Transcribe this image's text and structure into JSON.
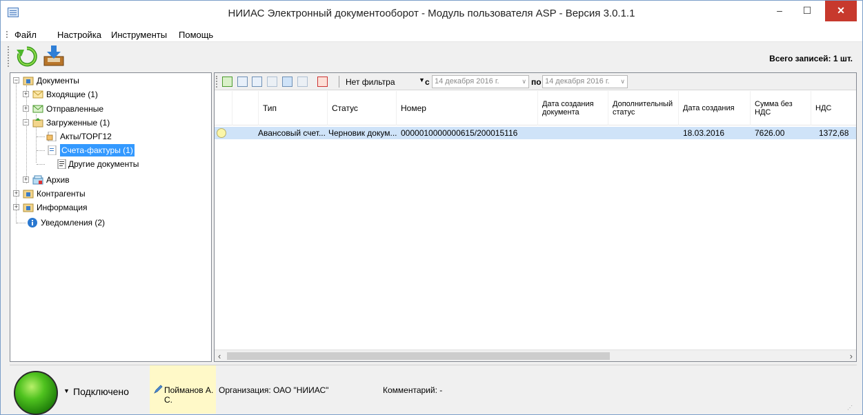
{
  "window": {
    "title": "НИИАС Электронный документооборот - Модуль пользователя ASP - Версия 3.0.1.1",
    "minimize": "–",
    "maximize": "☐",
    "close": "✕"
  },
  "menu": [
    "Файл",
    "Настройка",
    "Инструменты",
    "Помощь"
  ],
  "toolbar": {
    "total_records": "Всего записей: 1 шт.",
    "refresh_icon": "refresh-icon",
    "import_icon": "import-icon"
  },
  "tree": {
    "documents": "Документы",
    "incoming": "Входящие (1)",
    "sent": "Отправленные",
    "loaded": "Загруженные (1)",
    "acts": "Акты/ТОРГ12",
    "invoices": "Счета-фактуры (1)",
    "other_docs": "Другие документы",
    "archive": "Архив",
    "contractors": "Контрагенты",
    "information": "Информация",
    "notifications": "Уведомления (2)"
  },
  "grid_toolbar": {
    "filter": "Нет фильтра",
    "from_label": "с",
    "from_date": "14 декабря  2016 г.",
    "to_label": "по",
    "to_date": "14 декабря  2016 г."
  },
  "grid": {
    "columns": [
      "Тип",
      "Статус",
      "Номер",
      "Дата создания документа",
      "Дополнительный статус",
      "Дата создания",
      "Сумма без НДС",
      "НДС"
    ],
    "rows": [
      {
        "type": "Авансовый счет...",
        "status": "Черновик докум...",
        "number": "0000010000000615/200015116",
        "doc_date": "",
        "extra_status": "",
        "created": "18.03.2016",
        "sum_without_vat": "7626.00",
        "vat": "1372,68"
      }
    ]
  },
  "statusbar": {
    "connection": "Подключено",
    "user": "Пойманов А. С.",
    "organization": "Организация:  ОАО \"НИИАС\"",
    "comment": "Комментарий:  -"
  },
  "colors": {
    "selection": "#3399ff",
    "row_highlight": "#cfe3f8",
    "close_button": "#c7392d",
    "user_highlight": "#fff9c8"
  }
}
